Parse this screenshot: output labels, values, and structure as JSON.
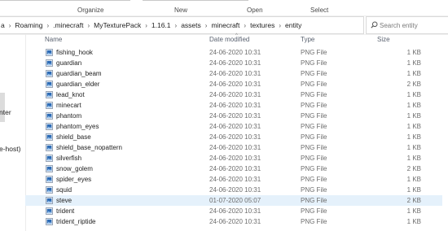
{
  "ribbon": {
    "organize": "Organize",
    "new": "New",
    "open": "Open",
    "select": "Select"
  },
  "address": {
    "crumbs": [
      "a",
      "Roaming",
      ".minecraft",
      "MyTexturePack",
      "1.16.1",
      "assets",
      "minecraft",
      "textures",
      "entity"
    ],
    "search_placeholder": "Search entity"
  },
  "nav": {
    "items": [
      "nter",
      "e-host)"
    ]
  },
  "columns": {
    "name": "Name",
    "date": "Date modified",
    "type": "Type",
    "size": "Size"
  },
  "files": [
    {
      "name": "fishing_hook",
      "date": "24-06-2020 10:31",
      "type": "PNG File",
      "size": "1 KB"
    },
    {
      "name": "guardian",
      "date": "24-06-2020 10:31",
      "type": "PNG File",
      "size": "1 KB"
    },
    {
      "name": "guardian_beam",
      "date": "24-06-2020 10:31",
      "type": "PNG File",
      "size": "1 KB"
    },
    {
      "name": "guardian_elder",
      "date": "24-06-2020 10:31",
      "type": "PNG File",
      "size": "2 KB"
    },
    {
      "name": "lead_knot",
      "date": "24-06-2020 10:31",
      "type": "PNG File",
      "size": "1 KB"
    },
    {
      "name": "minecart",
      "date": "24-06-2020 10:31",
      "type": "PNG File",
      "size": "1 KB"
    },
    {
      "name": "phantom",
      "date": "24-06-2020 10:31",
      "type": "PNG File",
      "size": "1 KB"
    },
    {
      "name": "phantom_eyes",
      "date": "24-06-2020 10:31",
      "type": "PNG File",
      "size": "1 KB"
    },
    {
      "name": "shield_base",
      "date": "24-06-2020 10:31",
      "type": "PNG File",
      "size": "1 KB"
    },
    {
      "name": "shield_base_nopattern",
      "date": "24-06-2020 10:31",
      "type": "PNG File",
      "size": "1 KB"
    },
    {
      "name": "silverfish",
      "date": "24-06-2020 10:31",
      "type": "PNG File",
      "size": "1 KB"
    },
    {
      "name": "snow_golem",
      "date": "24-06-2020 10:31",
      "type": "PNG File",
      "size": "2 KB"
    },
    {
      "name": "spider_eyes",
      "date": "24-06-2020 10:31",
      "type": "PNG File",
      "size": "1 KB"
    },
    {
      "name": "squid",
      "date": "24-06-2020 10:31",
      "type": "PNG File",
      "size": "1 KB"
    },
    {
      "name": "steve",
      "date": "01-07-2020 05:07",
      "type": "PNG File",
      "size": "2 KB",
      "selected": true
    },
    {
      "name": "trident",
      "date": "24-06-2020 10:31",
      "type": "PNG File",
      "size": "1 KB"
    },
    {
      "name": "trident_riptide",
      "date": "24-06-2020 10:31",
      "type": "PNG File",
      "size": "1 KB"
    }
  ],
  "colors": {
    "selection": "#e5f1fb",
    "header_text": "#5a6270",
    "icon_blue": "#2d6bb5"
  },
  "icons": {
    "file": "png-image-file-icon",
    "search": "search-icon"
  }
}
